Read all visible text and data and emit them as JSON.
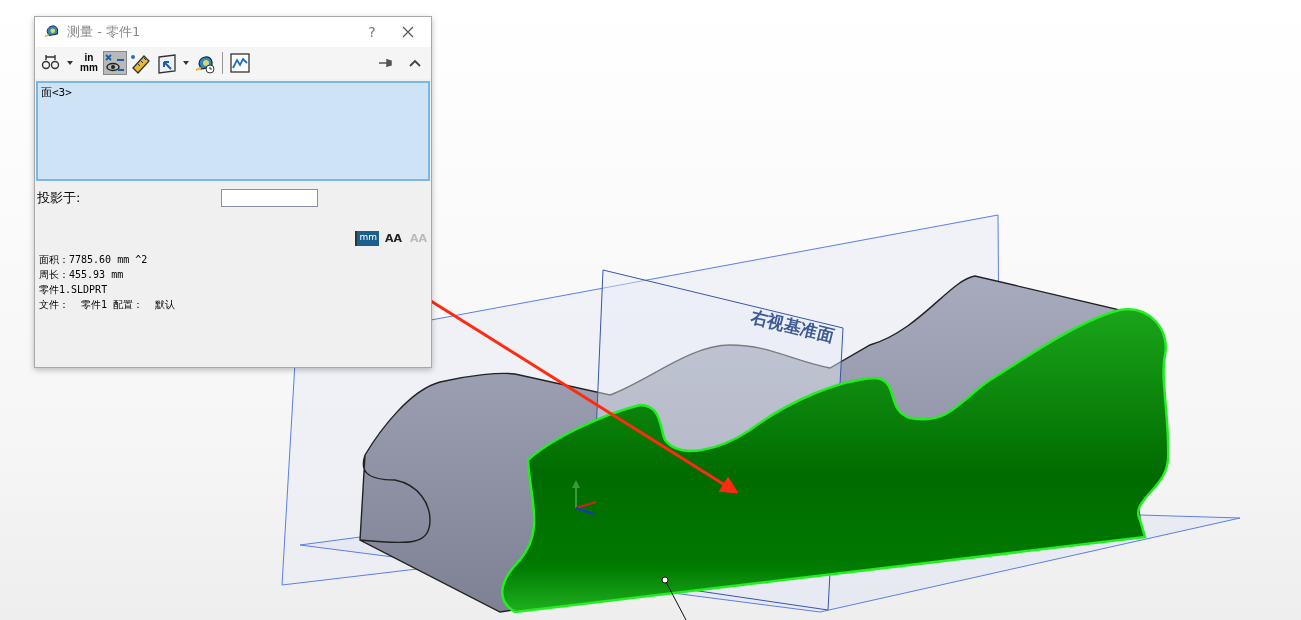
{
  "dialog": {
    "title": "测量 - 零件1",
    "help": "?",
    "toolbar": [
      {
        "kind": "arc",
        "selected": false,
        "dropdown": true
      },
      {
        "kind": "units",
        "top": "in",
        "bottom": "mm",
        "selected": false,
        "dropdown": false
      },
      {
        "kind": "xyz",
        "selected": true,
        "dropdown": false
      },
      {
        "kind": "ruler",
        "selected": false,
        "dropdown": false
      },
      {
        "kind": "projection",
        "selected": false,
        "dropdown": true
      },
      {
        "kind": "history",
        "selected": false,
        "dropdown": false
      },
      {
        "kind": "graph",
        "selected": false,
        "dropdown": false
      }
    ],
    "selection_list": [
      {
        "label": "面<3>",
        "selected": true
      }
    ],
    "projection": {
      "label": "投影于:"
    },
    "text_tools": [
      {
        "kind": "units",
        "label": "mm",
        "disabled": false
      },
      {
        "kind": "larger",
        "label": "AA",
        "disabled": false
      },
      {
        "kind": "smaller",
        "label": "AA",
        "disabled": true
      }
    ],
    "results": [
      "面积：7785.60 mm ^2",
      "周长：455.93 mm",
      "零件1.SLDPRT",
      "文件：  零件1 配置：  默认"
    ]
  },
  "viewport": {
    "plane_label": "右视基准面",
    "face_selected": true
  }
}
